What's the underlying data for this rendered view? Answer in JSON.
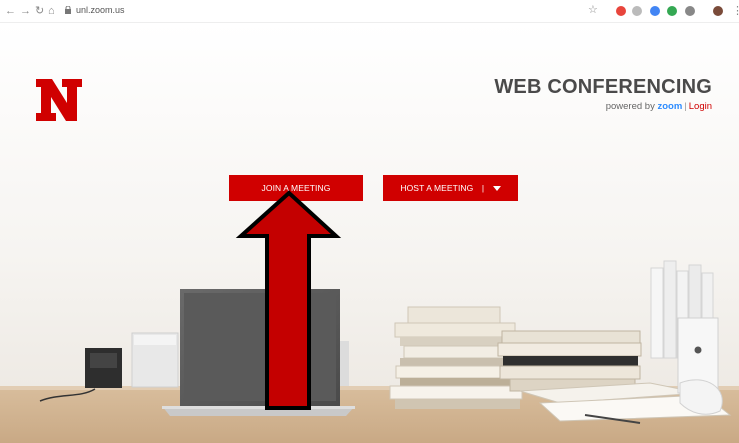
{
  "browser": {
    "url": "unl.zoom.us"
  },
  "header": {
    "logo_letter": "N",
    "title": "WEB CONFERENCING",
    "powered_by": "powered by",
    "zoom_label": "zoom",
    "separator": "|",
    "login_label": "Login"
  },
  "actions": {
    "join_label": "JOIN A MEETING",
    "host_label": "HOST A MEETING",
    "host_separator": "|"
  },
  "colors": {
    "brand_red": "#d00000",
    "arrow_red": "#c40000",
    "zoom_blue": "#2d8cff"
  }
}
